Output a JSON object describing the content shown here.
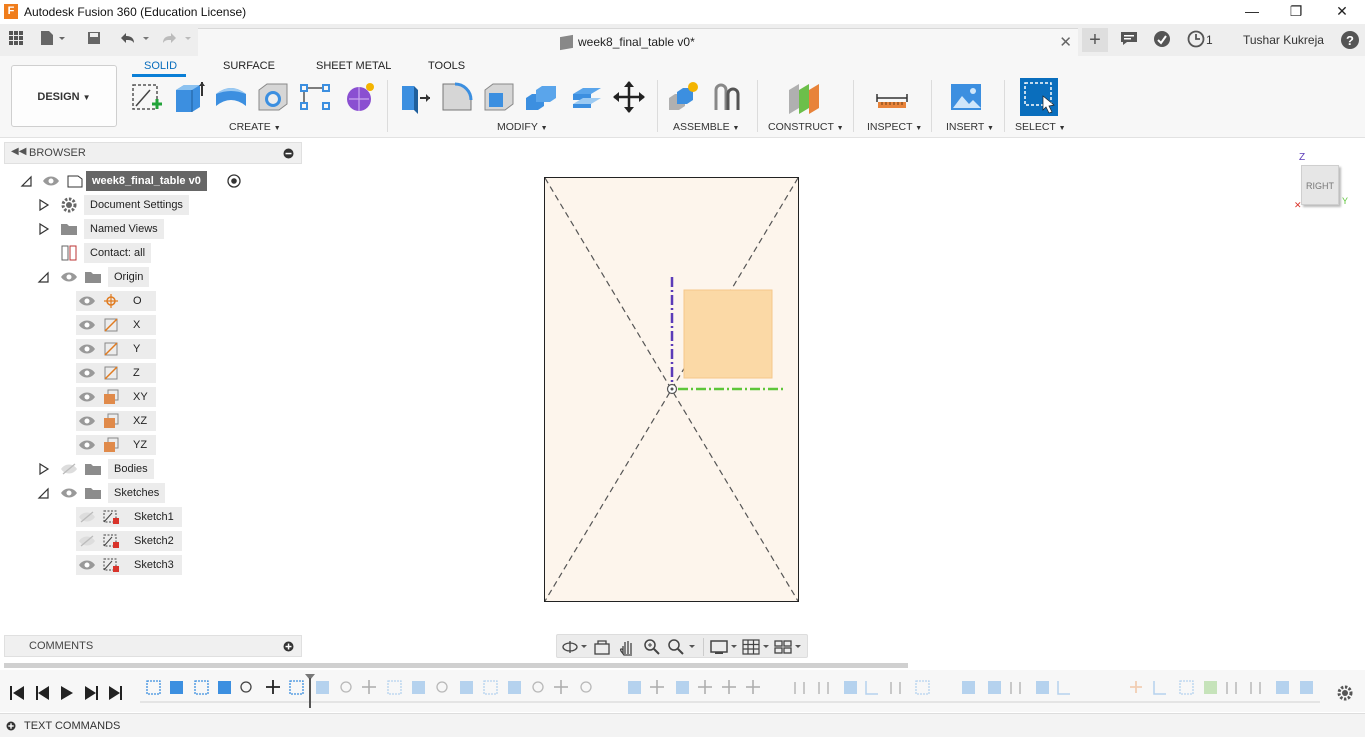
{
  "app": {
    "window_title": "Autodesk Fusion 360 (Education License)",
    "logo_letter": "F"
  },
  "document": {
    "tab_title": "week8_final_table v0*",
    "notifications_count": "1",
    "user_name": "Tushar Kukreja"
  },
  "toolbar": {
    "workspace_label": "DESIGN",
    "tabs": [
      "SOLID",
      "SURFACE",
      "SHEET METAL",
      "TOOLS"
    ],
    "active_tab": "SOLID",
    "groups": {
      "create": "CREATE",
      "modify": "MODIFY",
      "assemble": "ASSEMBLE",
      "construct": "CONSTRUCT",
      "inspect": "INSPECT",
      "insert": "INSERT",
      "select": "SELECT"
    },
    "colors": {
      "accent": "#0a7fd6",
      "create_icon_blue": "#3c8fe0",
      "construct_icon_orange": "#e8833a",
      "construct_icon_green": "#6cbf4a"
    }
  },
  "browser": {
    "header_label": "BROWSER",
    "root": "week8_final_table v0",
    "items": {
      "document_settings": "Document Settings",
      "named_views": "Named Views",
      "contact": "Contact: all",
      "origin": "Origin",
      "origin_o": "O",
      "origin_x": "X",
      "origin_y": "Y",
      "origin_z": "Z",
      "origin_xy": "XY",
      "origin_xz": "XZ",
      "origin_yz": "YZ",
      "bodies": "Bodies",
      "sketches": "Sketches",
      "sketch1": "Sketch1",
      "sketch2": "Sketch2",
      "sketch3": "Sketch3"
    }
  },
  "viewcube": {
    "face_label": "RIGHT",
    "axis_label": "Z",
    "side_label": "Y"
  },
  "comments": {
    "label": "COMMENTS"
  },
  "text_commands": {
    "label": "TEXT COMMANDS"
  },
  "canvas": {
    "sketch_fill": "#fdf5ec",
    "profile_fill": "#fbd9a6",
    "axis_green": "#5ec63a",
    "axis_purple": "#5b3bb8"
  }
}
